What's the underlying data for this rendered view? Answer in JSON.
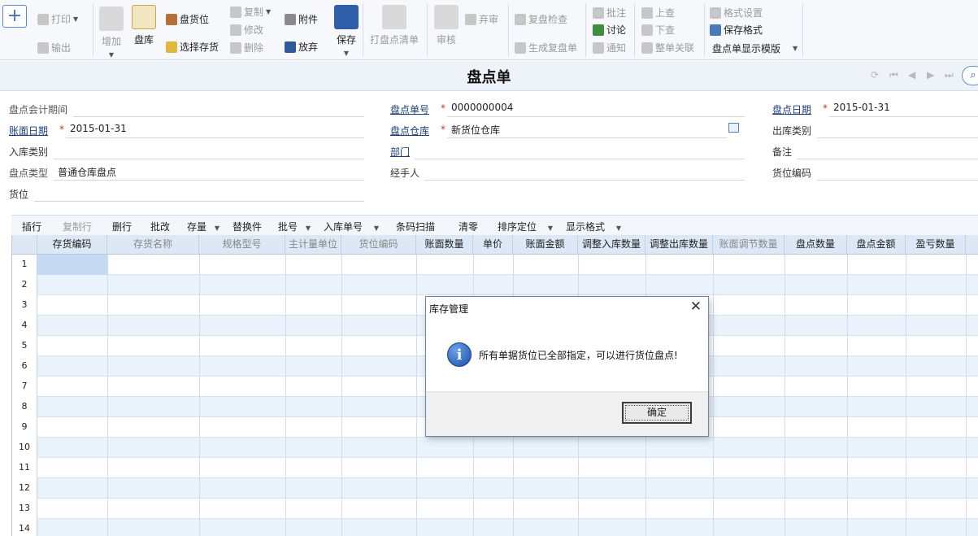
{
  "toolbar": {
    "print": "打印",
    "export": "输出",
    "add": "增加",
    "count_stock": "盘库",
    "count_location": "盘货位",
    "select_inventory": "选择存货",
    "copy": "复制",
    "modify": "修改",
    "delete": "删除",
    "attachment": "附件",
    "discard": "放弃",
    "save": "保存",
    "print_count_list": "打盘点清单",
    "audit": "审核",
    "abandon_audit": "弃审",
    "recheck": "复盘检查",
    "generate_recheck": "生成复盘单",
    "annotate": "批注",
    "discuss": "讨论",
    "notify": "通知",
    "prev_query": "上查",
    "next_query": "下查",
    "whole_doc_link": "整单关联",
    "format_settings": "格式设置",
    "save_format": "保存格式",
    "template_select": "盘点单显示模版"
  },
  "page": {
    "title": "盘点单"
  },
  "form": {
    "count_period": {
      "label": "盘点会计期间",
      "value": ""
    },
    "doc_no": {
      "label": "盘点单号",
      "value": "0000000004"
    },
    "count_date": {
      "label": "盘点日期",
      "value": "2015-01-31"
    },
    "book_date": {
      "label": "账面日期",
      "value": "2015-01-31"
    },
    "warehouse": {
      "label": "盘点仓库",
      "value": "新货位仓库"
    },
    "out_type": {
      "label": "出库类别",
      "value": ""
    },
    "in_type": {
      "label": "入库类别",
      "value": ""
    },
    "dept": {
      "label": "部门",
      "value": ""
    },
    "remark": {
      "label": "备注",
      "value": ""
    },
    "count_type": {
      "label": "盘点类型",
      "value": "普通仓库盘点"
    },
    "handler": {
      "label": "经手人",
      "value": ""
    },
    "location_code": {
      "label": "货位编码",
      "value": ""
    },
    "location": {
      "label": "货位",
      "value": ""
    }
  },
  "gridbar": {
    "insert": "插行",
    "copy_row": "复制行",
    "delete_row": "删行",
    "batch_edit": "批改",
    "stock": "存量",
    "replace": "替换件",
    "batch_no": "批号",
    "in_doc_no": "入库单号",
    "barcode": "条码扫描",
    "clear": "清零",
    "sort": "排序定位",
    "display": "显示格式"
  },
  "grid": {
    "columns": [
      "存货编码",
      "存货名称",
      "规格型号",
      "主计量单位",
      "货位编码",
      "账面数量",
      "单价",
      "账面金额",
      "调整入库数量",
      "调整出库数量",
      "账面调节数量",
      "盘点数量",
      "盘点金额",
      "盈亏数量"
    ],
    "rows": [
      "1",
      "2",
      "3",
      "4",
      "5",
      "6",
      "7",
      "8",
      "9",
      "10",
      "11",
      "12",
      "13",
      "14"
    ]
  },
  "dialog": {
    "title": "库存管理",
    "message": "所有单据货位已全部指定，可以进行货位盘点!",
    "ok": "确定"
  }
}
